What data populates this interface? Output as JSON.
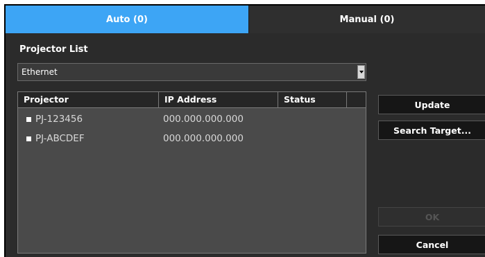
{
  "tabs": {
    "auto_label": "Auto (0)",
    "manual_label": "Manual (0)"
  },
  "projector_list": {
    "heading": "Projector List",
    "interface_select": {
      "value": "Ethernet"
    }
  },
  "table": {
    "columns": [
      "Projector",
      "IP Address",
      "Status"
    ],
    "rows": [
      {
        "projector": "PJ-123456",
        "ip": "000.000.000.000",
        "status": ""
      },
      {
        "projector": "PJ-ABCDEF",
        "ip": "000.000.000.000",
        "status": ""
      }
    ]
  },
  "buttons": {
    "update": "Update",
    "search_target": "Search Target...",
    "ok": "OK",
    "cancel": "Cancel"
  },
  "colors": {
    "active_tab": "#3da5f5",
    "background": "#2b2b2b",
    "table_background": "#4a4a4a"
  }
}
